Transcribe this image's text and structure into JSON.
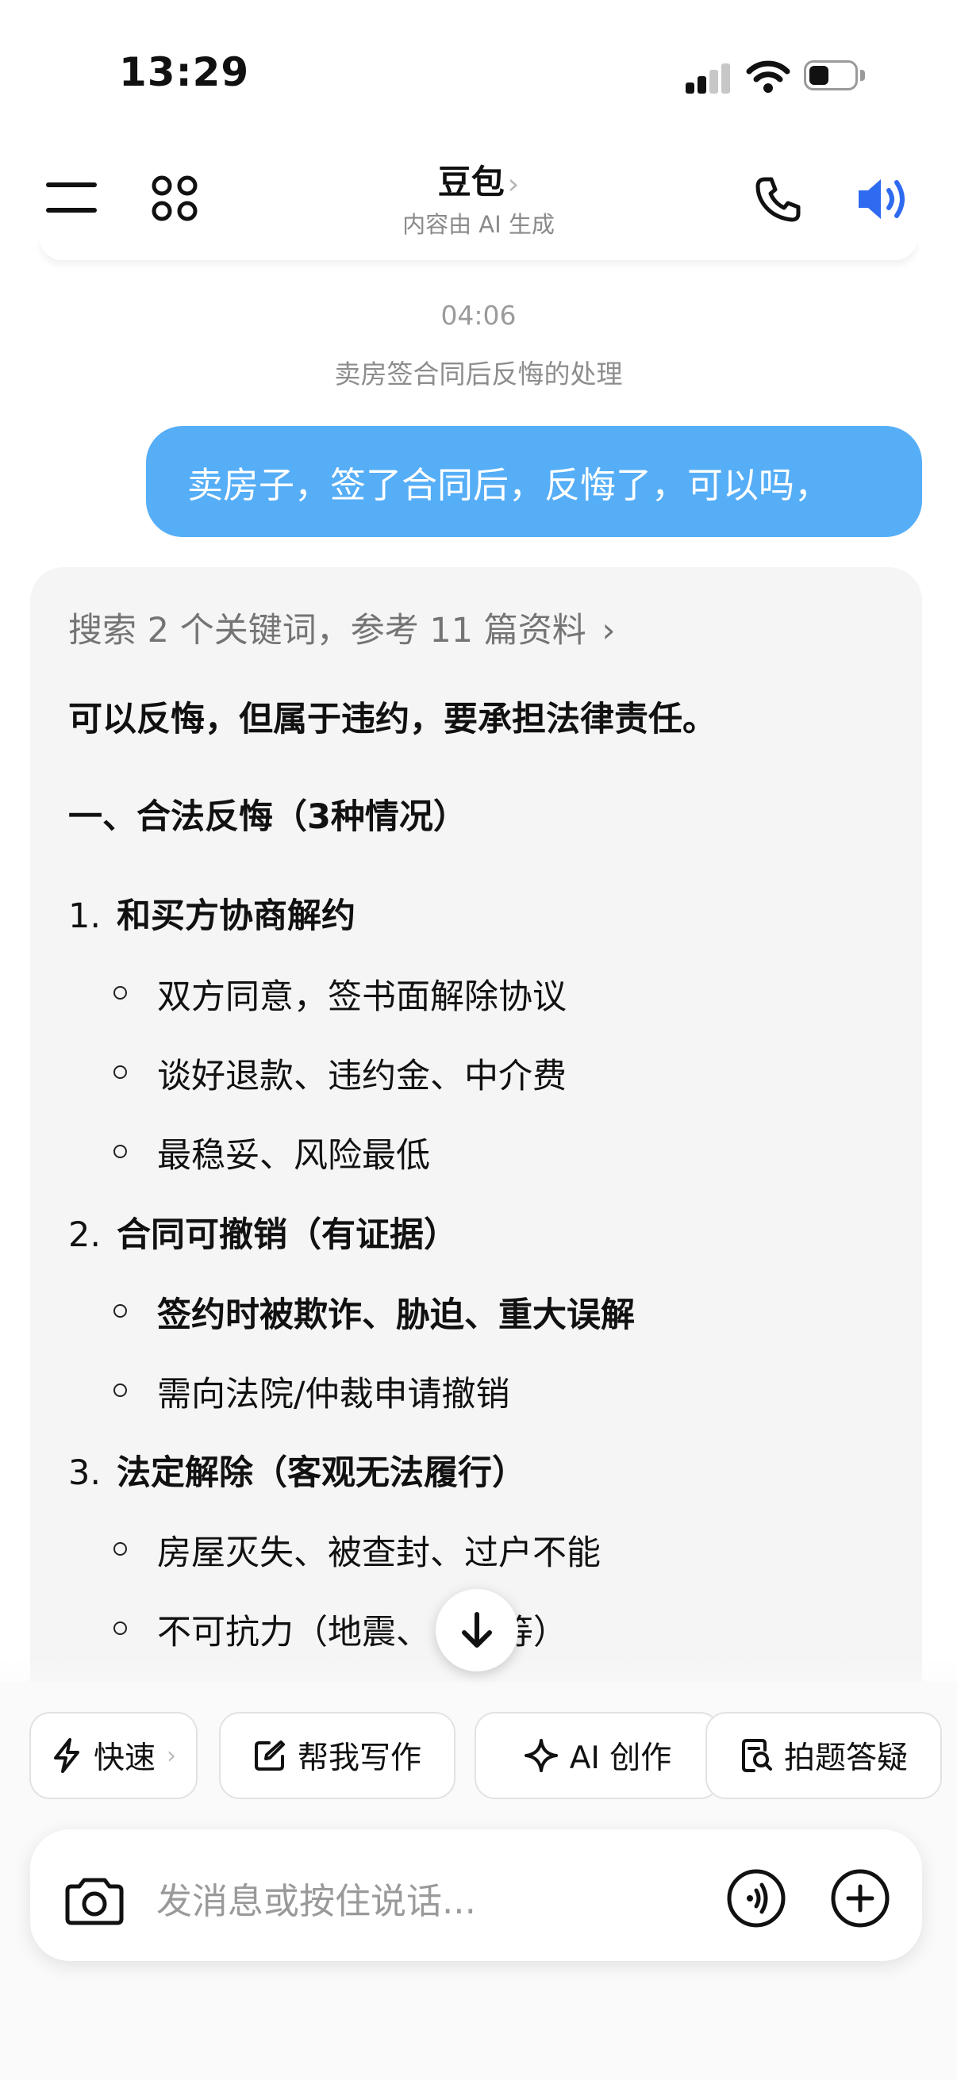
{
  "status_bar": {
    "time": "13:29"
  },
  "header": {
    "title": "豆包",
    "title_chevron": "›",
    "subtitle": "内容由 AI 生成",
    "icons": [
      "menu-icon",
      "apps-grid-icon",
      "phone-icon",
      "speaker-icon"
    ],
    "accent": "#2f6bf0"
  },
  "chat": {
    "timestamp": "04:06",
    "topic": "卖房签合同后反悔的处理",
    "user_message": "卖房子，签了合同后，反悔了，可以吗，",
    "user_bubble_color": "#56aef7",
    "ai": {
      "search_summary": "搜索 2 个关键词，参考 11 篇资料",
      "search_chevron": "›",
      "lead": "可以反悔，但属于违约，要承担法律责任。",
      "section_heading": "一、合法反悔（3种情况）",
      "items": [
        {
          "num": "1.",
          "title": "和买方协商解约",
          "points": [
            "双方同意，签书面解除协议",
            "谈好退款、违约金、中介费",
            "最稳妥、风险最低"
          ]
        },
        {
          "num": "2.",
          "title": "合同可撤销（有证据）",
          "points": [
            "签约时被欺诈、胁迫、重大误解",
            "需向法院/仲裁申请撤销"
          ]
        },
        {
          "num": "3.",
          "title": "法定解除（客观无法履行）",
          "points": [
            "房屋灭失、被查封、过户不能",
            "不可抗力（地震、",
            "政等）"
          ]
        }
      ]
    }
  },
  "quick_actions": [
    {
      "label": "快速",
      "extra": "›",
      "icon": "lightning-icon"
    },
    {
      "label": "帮我写作",
      "icon": "edit-icon"
    },
    {
      "label": "AI 创作",
      "icon": "sparkle-icon"
    },
    {
      "label": "拍题答疑",
      "icon": "scan-question-icon"
    }
  ],
  "input": {
    "placeholder": "发消息或按住说话...",
    "icons": [
      "camera-icon",
      "voice-wave-icon",
      "plus-icon"
    ]
  }
}
